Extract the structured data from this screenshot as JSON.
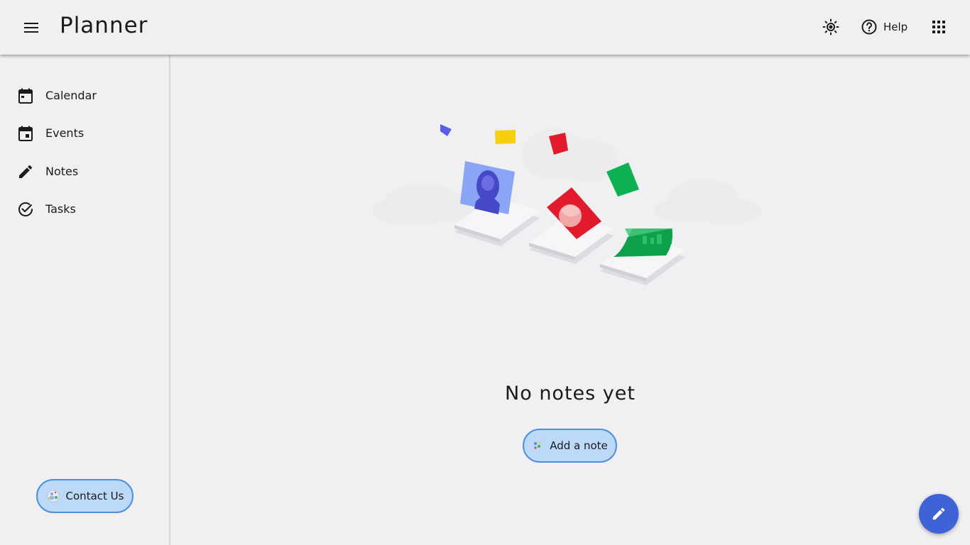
{
  "header": {
    "app_title": "Planner",
    "help_label": "Help",
    "icons": {
      "menu": "menu-icon",
      "theme": "brightness-icon",
      "help": "help-circle-icon",
      "apps": "apps-grid-icon"
    }
  },
  "sidebar": {
    "items": [
      {
        "label": "Calendar",
        "icon": "calendar-icon"
      },
      {
        "label": "Events",
        "icon": "event-icon"
      },
      {
        "label": "Notes",
        "icon": "pencil-icon"
      },
      {
        "label": "Tasks",
        "icon": "check-circle-icon"
      }
    ],
    "contact_label": "Contact Us"
  },
  "main": {
    "empty_title": "No notes yet",
    "add_label": "Add a note"
  },
  "colors": {
    "accent": "#3f63d6",
    "button_fill": "#bcd9f7",
    "button_border": "#4c8fe0",
    "background": "#f0f0f2"
  }
}
